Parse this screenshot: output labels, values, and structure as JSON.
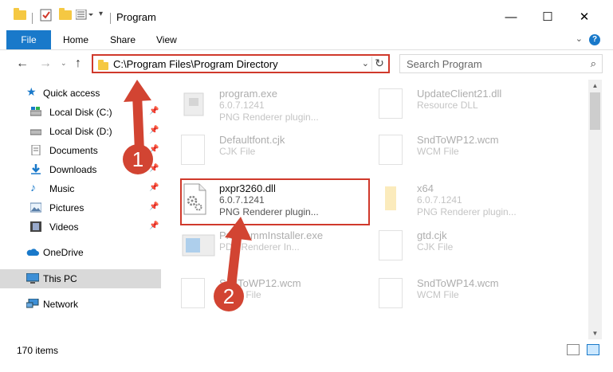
{
  "window": {
    "title": "Program",
    "minimize": "—",
    "maximize": "☐",
    "close": "✕"
  },
  "ribbon": {
    "tabs": [
      "File",
      "Home",
      "Share",
      "View"
    ],
    "help": "?"
  },
  "address": {
    "path": "C:\\Program Files\\Program Directory",
    "search_placeholder": "Search Program"
  },
  "sidebar": {
    "items": [
      {
        "label": "Quick access",
        "icon": "star-icon",
        "pinned": false
      },
      {
        "label": "Local Disk (C:)",
        "icon": "drive-icon",
        "pinned": true
      },
      {
        "label": "Local Disk (D:)",
        "icon": "drive-icon",
        "pinned": true
      },
      {
        "label": "Documents",
        "icon": "documents-icon",
        "pinned": true
      },
      {
        "label": "Downloads",
        "icon": "download-icon",
        "pinned": true
      },
      {
        "label": "Music",
        "icon": "music-icon",
        "pinned": true
      },
      {
        "label": "Pictures",
        "icon": "pictures-icon",
        "pinned": true
      },
      {
        "label": "Videos",
        "icon": "videos-icon",
        "pinned": true
      },
      {
        "label": "OneDrive",
        "icon": "cloud-icon",
        "pinned": false
      },
      {
        "label": "This PC",
        "icon": "computer-icon",
        "pinned": false
      },
      {
        "label": "Network",
        "icon": "network-icon",
        "pinned": false
      }
    ]
  },
  "files": [
    {
      "name": "program.exe",
      "line2": "6.0.7.1241",
      "line3": "PNG Renderer plugin..."
    },
    {
      "name": "UpdateClient21.dll",
      "line2": "Resource DLL",
      "line3": ""
    },
    {
      "name": "Defaultfont.cjk",
      "line2": "CJK File",
      "line3": ""
    },
    {
      "name": "SndToWP12.wcm",
      "line2": "WCM File",
      "line3": ""
    },
    {
      "name": "pxpr3260.dll",
      "line2": "6.0.7.1241",
      "line3": "PNG Renderer plugin..."
    },
    {
      "name": "x64",
      "line2": "6.0.7.1241",
      "line3": "PNG Renderer plugin..."
    },
    {
      "name": "ProgrammInstaller.exe",
      "line2": "PDF Renderer In...",
      "line3": ""
    },
    {
      "name": "gtd.cjk",
      "line2": "CJK File",
      "line3": ""
    },
    {
      "name": "SndToWP12.wcm",
      "line2": "WCM File",
      "line3": ""
    },
    {
      "name": "SndToWP14.wcm",
      "line2": "WCM File",
      "line3": ""
    }
  ],
  "status": {
    "count": "170 items"
  },
  "callouts": {
    "one": "1",
    "two": "2"
  },
  "colors": {
    "accent": "#1979ca",
    "highlight": "#d0392b",
    "callout": "#d24432"
  }
}
